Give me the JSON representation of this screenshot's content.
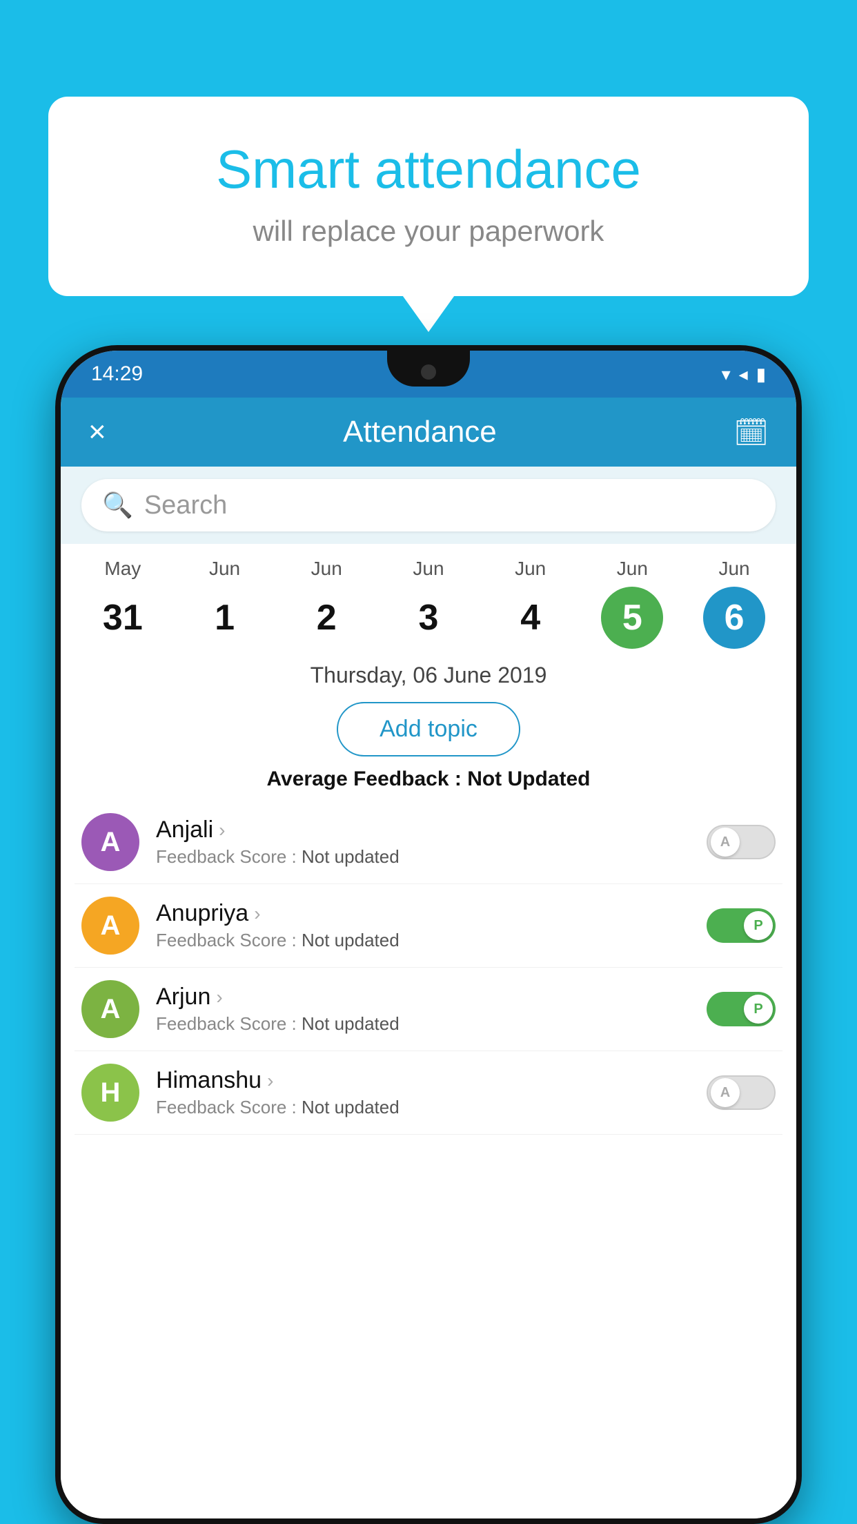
{
  "background_color": "#1BBDE8",
  "bubble": {
    "title": "Smart attendance",
    "subtitle": "will replace your paperwork"
  },
  "status_bar": {
    "time": "14:29",
    "icons": [
      "wifi",
      "signal",
      "battery"
    ]
  },
  "app_bar": {
    "close_label": "×",
    "title": "Attendance",
    "calendar_icon": "📅"
  },
  "search": {
    "placeholder": "Search"
  },
  "calendar": {
    "days": [
      {
        "month": "May",
        "date": "31",
        "style": "normal"
      },
      {
        "month": "Jun",
        "date": "1",
        "style": "normal"
      },
      {
        "month": "Jun",
        "date": "2",
        "style": "normal"
      },
      {
        "month": "Jun",
        "date": "3",
        "style": "normal"
      },
      {
        "month": "Jun",
        "date": "4",
        "style": "normal"
      },
      {
        "month": "Jun",
        "date": "5",
        "style": "selected-green"
      },
      {
        "month": "Jun",
        "date": "6",
        "style": "selected-blue"
      }
    ]
  },
  "selected_date_label": "Thursday, 06 June 2019",
  "add_topic_label": "Add topic",
  "avg_feedback_label": "Average Feedback :",
  "avg_feedback_value": "Not Updated",
  "students": [
    {
      "name": "Anjali",
      "avatar_letter": "A",
      "avatar_color": "#9B59B6",
      "feedback_label": "Feedback Score :",
      "feedback_value": "Not updated",
      "toggle_state": "off",
      "toggle_label": "A"
    },
    {
      "name": "Anupriya",
      "avatar_letter": "A",
      "avatar_color": "#F5A623",
      "feedback_label": "Feedback Score :",
      "feedback_value": "Not updated",
      "toggle_state": "on",
      "toggle_label": "P"
    },
    {
      "name": "Arjun",
      "avatar_letter": "A",
      "avatar_color": "#7CB342",
      "feedback_label": "Feedback Score :",
      "feedback_value": "Not updated",
      "toggle_state": "on",
      "toggle_label": "P"
    },
    {
      "name": "Himanshu",
      "avatar_letter": "H",
      "avatar_color": "#8BC34A",
      "feedback_label": "Feedback Score :",
      "feedback_value": "Not updated",
      "toggle_state": "off",
      "toggle_label": "A"
    }
  ]
}
